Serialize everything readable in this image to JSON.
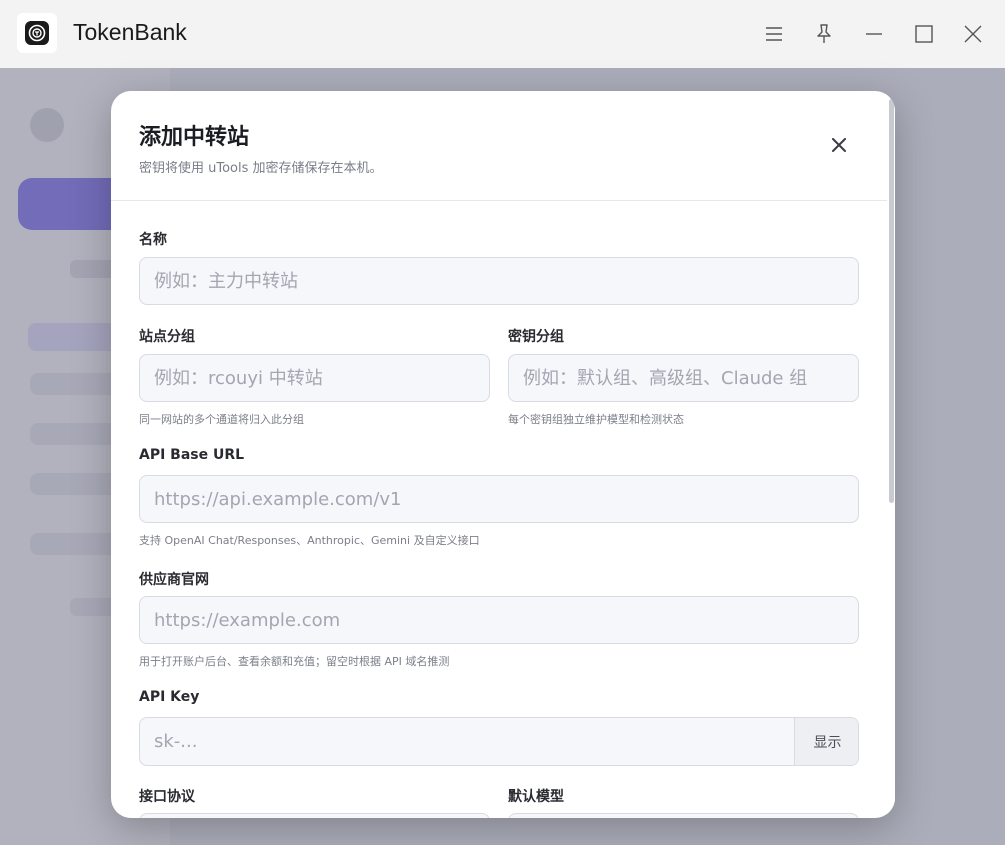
{
  "window": {
    "title": "TokenBank"
  },
  "modal": {
    "title": "添加中转站",
    "subtitle": "密钥将使用 uTools 加密存储保存在本机。",
    "fields": {
      "name": {
        "label": "名称",
        "placeholder": "例如：主力中转站",
        "value": ""
      },
      "site_group": {
        "label": "站点分组",
        "placeholder": "例如：rcouyi 中转站",
        "hint": "同一网站的多个通道将归入此分组",
        "value": ""
      },
      "key_group": {
        "label": "密钥分组",
        "placeholder": "例如：默认组、高级组、Claude 组",
        "hint": "每个密钥组独立维护模型和检测状态",
        "value": ""
      },
      "api_base_url": {
        "label": "API Base URL",
        "placeholder": "https://api.example.com/v1",
        "hint": "支持 OpenAI Chat/Responses、Anthropic、Gemini 及自定义接口",
        "value": ""
      },
      "vendor_site": {
        "label": "供应商官网",
        "placeholder": "https://example.com",
        "hint": "用于打开账户后台、查看余额和充值；留空时根据 API 域名推测",
        "value": ""
      },
      "api_key": {
        "label": "API Key",
        "placeholder": "sk-...",
        "show_label": "显示",
        "value": ""
      },
      "protocol": {
        "label": "接口协议"
      },
      "default_model": {
        "label": "默认模型"
      }
    }
  },
  "colors": {
    "accent": "#6a5cf0",
    "overlay": "#787a8c"
  }
}
